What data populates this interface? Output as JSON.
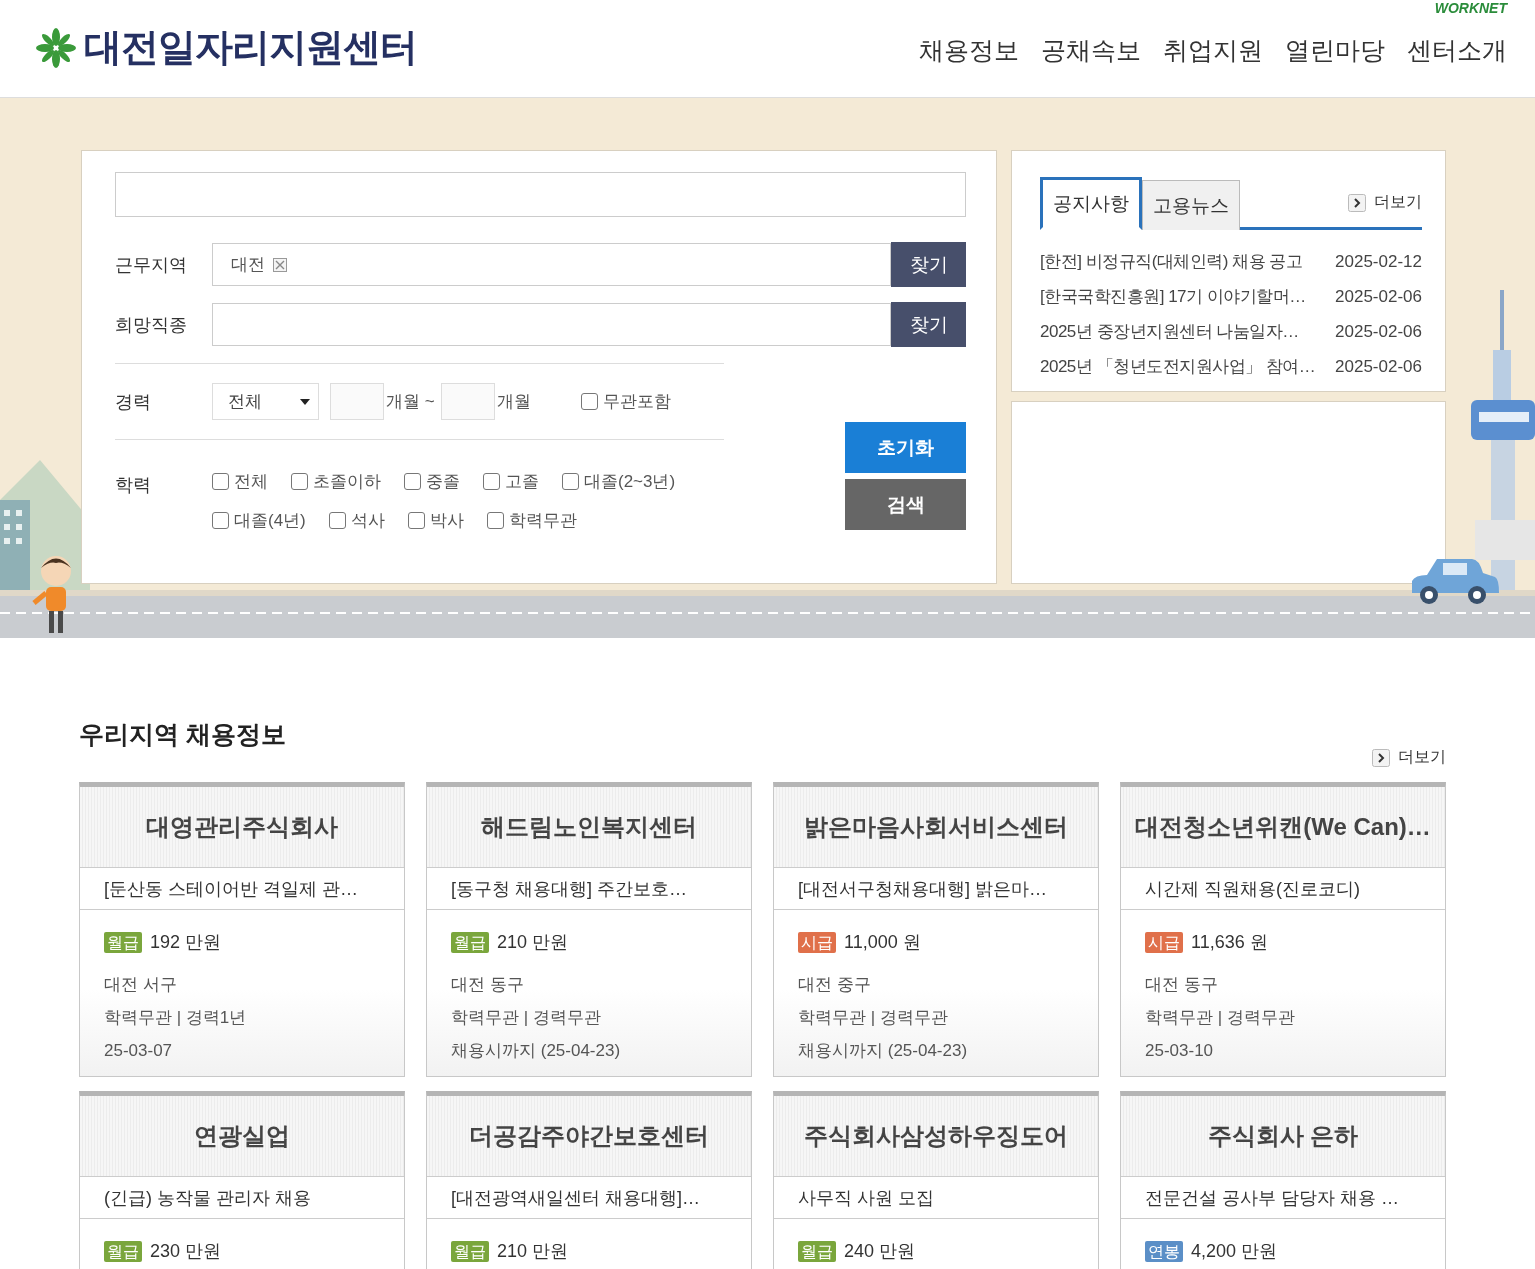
{
  "header": {
    "logo_text": "대전일자리지원센터",
    "partner_logo": "WORKNET",
    "nav": [
      "채용정보",
      "공채속보",
      "취업지원",
      "열린마당",
      "센터소개"
    ]
  },
  "search": {
    "region": {
      "label": "근무지역",
      "tag": "대전",
      "button": "찾기"
    },
    "job": {
      "label": "희망직종",
      "button": "찾기"
    },
    "career": {
      "label": "경력",
      "select": "전체",
      "unit_from": "개월 ~",
      "unit_to": "개월",
      "any": {
        "label": "무관포함",
        "checked": false
      }
    },
    "education": {
      "label": "학력",
      "options": [
        {
          "label": "전체",
          "checked": false
        },
        {
          "label": "초졸이하",
          "checked": false
        },
        {
          "label": "중졸",
          "checked": false
        },
        {
          "label": "고졸",
          "checked": false
        },
        {
          "label": "대졸(2~3년)",
          "checked": false
        },
        {
          "label": "대졸(4년)",
          "checked": false
        },
        {
          "label": "석사",
          "checked": false
        },
        {
          "label": "박사",
          "checked": false
        },
        {
          "label": "학력무관",
          "checked": false
        }
      ]
    },
    "reset_button": "초기화",
    "search_button": "검색"
  },
  "notice": {
    "tabs": [
      {
        "label": "공지사항",
        "selected": true
      },
      {
        "label": "고용뉴스",
        "selected": false
      }
    ],
    "more": "더보기",
    "items": [
      {
        "title": "[한전] 비정규직(대체인력) 채용 공고",
        "date": "2025-02-12"
      },
      {
        "title": "[한국국학진흥원] 17기 이야기할머…",
        "date": "2025-02-06"
      },
      {
        "title": "2025년 중장년지원센터 나눔일자…",
        "date": "2025-02-06"
      },
      {
        "title": "2025년 「청년도전지원사업」 참여…",
        "date": "2025-02-06"
      }
    ]
  },
  "jobs": {
    "title": "우리지역 채용정보",
    "more": "더보기",
    "cards": [
      {
        "company": "대영관리주식회사",
        "title": "[둔산동 스테이어반 격일제 관…",
        "pay_type": "월급",
        "color": "#7aa63c",
        "pay": "192 만원",
        "location": "대전 서구",
        "condition": "학력무관 | 경력1년",
        "deadline": "25-03-07"
      },
      {
        "company": "해드림노인복지센터",
        "title": "[동구청 채용대행] 주간보호…",
        "pay_type": "월급",
        "color": "#7aa63c",
        "pay": "210 만원",
        "location": "대전 동구",
        "condition": "학력무관 | 경력무관",
        "deadline": "채용시까지 (25-04-23)"
      },
      {
        "company": "밝은마음사회서비스센터",
        "title": "[대전서구청채용대행] 밝은마…",
        "pay_type": "시급",
        "color": "#e0704a",
        "pay": "11,000 원",
        "location": "대전 중구",
        "condition": "학력무관 | 경력무관",
        "deadline": "채용시까지 (25-04-23)"
      },
      {
        "company": "대전청소년위캔(We Can)…",
        "title": "시간제 직원채용(진로코디)",
        "pay_type": "시급",
        "color": "#e0704a",
        "pay": "11,636 원",
        "location": "대전 동구",
        "condition": "학력무관 | 경력무관",
        "deadline": "25-03-10"
      },
      {
        "company": "연광실업",
        "title": "(긴급) 농작물 관리자 채용",
        "pay_type": "월급",
        "color": "#7aa63c",
        "pay": "230 만원"
      },
      {
        "company": "더공감주야간보호센터",
        "title": "[대전광역새일센터 채용대행]…",
        "pay_type": "월급",
        "color": "#7aa63c",
        "pay": "210 만원"
      },
      {
        "company": "주식회사삼성하우징도어",
        "title": "사무직 사원 모집",
        "pay_type": "월급",
        "color": "#7aa63c",
        "pay": "240 만원"
      },
      {
        "company": "주식회사 은하",
        "title": "전문건설 공사부 담당자 채용 …",
        "pay_type": "연봉",
        "color": "#5b8fc7",
        "pay": "4,200 만원"
      }
    ]
  }
}
